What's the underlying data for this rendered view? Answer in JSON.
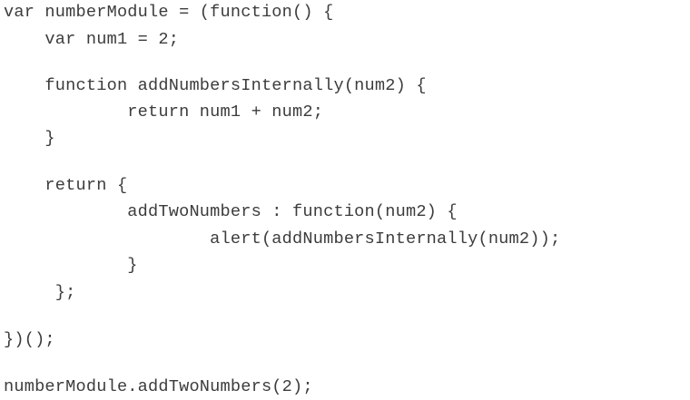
{
  "code": {
    "lines": [
      "var numberModule = (function() {",
      "    var num1 = 2;",
      "    function addNumbersInternally(num2) {",
      "            return num1 + num2;",
      "    }",
      "    return {",
      "            addTwoNumbers : function(num2) {",
      "                    alert(addNumbersInternally(num2));",
      "            }",
      "     };",
      "})();",
      "numberModule.addTwoNumbers(2);"
    ]
  }
}
